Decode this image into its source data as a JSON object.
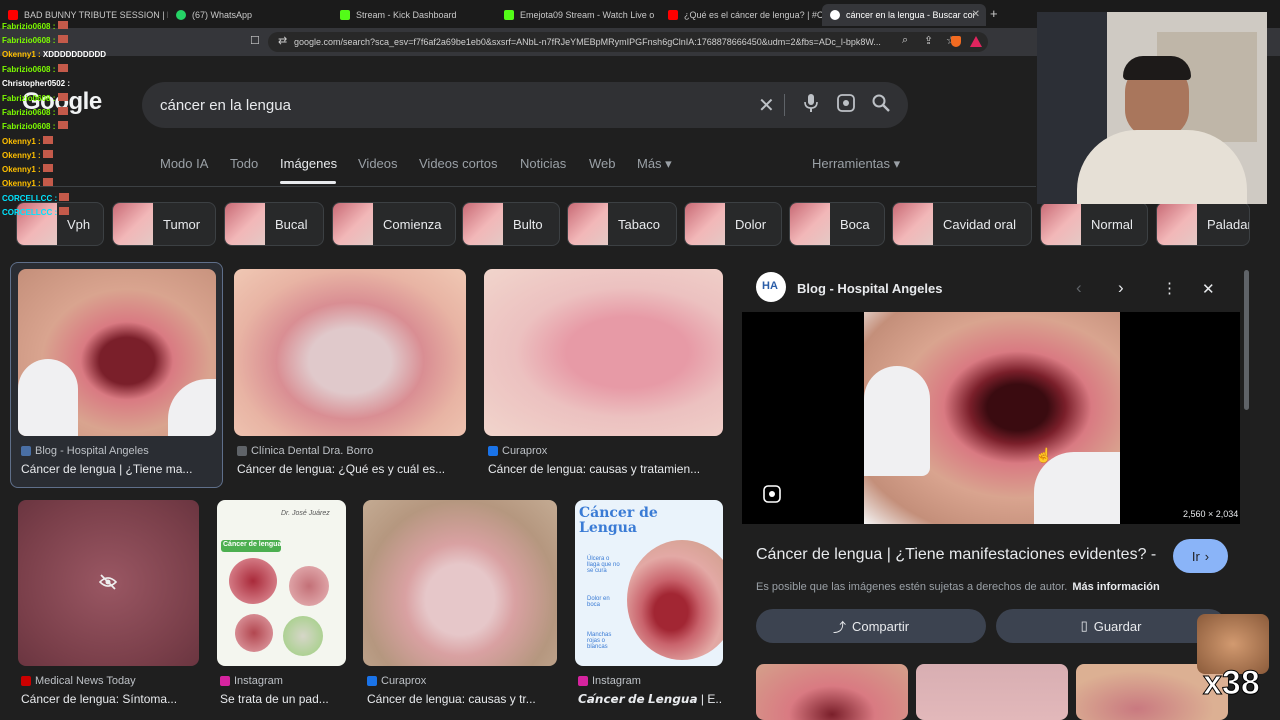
{
  "browser": {
    "tabs": [
      {
        "label": "BAD BUNNY TRIBUTE SESSION | DtM",
        "color": "#ff0000"
      },
      {
        "label": "(67) WhatsApp",
        "color": "#25d366"
      },
      {
        "label": "Stream - Kick Dashboard",
        "color": "#53fc18"
      },
      {
        "label": "Emejota09 Stream - Watch Live o",
        "color": "#53fc18"
      },
      {
        "label": "¿Qué es el cáncer de lengua? | #Cáp",
        "color": "#ff0000"
      },
      {
        "label": "cáncer en la lengua - Buscar con",
        "color": "#ffffff"
      }
    ],
    "url": "google.com/search?sca_esv=f7f6af2a69be1eb0&sxsrf=ANbL-n7fRJeYMEBpMRymIPGFnsh6gClnIA:1768878666450&udm=2&fbs=ADc_l-bpk8W..."
  },
  "search": {
    "logo": "Google",
    "query": "cáncer en la lengua"
  },
  "nav": {
    "tabs": [
      "Modo IA",
      "Todo",
      "Imágenes",
      "Videos",
      "Videos cortos",
      "Noticias",
      "Web",
      "Más ▾"
    ],
    "tools": "Herramientas ▾"
  },
  "chips": [
    "Vph",
    "Tumor",
    "Bucal",
    "Comienza",
    "Bulto",
    "Tabaco",
    "Dolor",
    "Boca",
    "Cavidad oral",
    "Normal",
    "Paladar"
  ],
  "results": [
    {
      "source": "Blog - Hospital Angeles",
      "title": "Cáncer de lengua | ¿Tiene ma..."
    },
    {
      "source": "Clínica Dental Dra. Borro",
      "title": "Cáncer de lengua: ¿Qué es y cuál es..."
    },
    {
      "source": "Curaprox",
      "title": "Cáncer de lengua: causas y tratamien..."
    },
    {
      "source": "Medical News Today",
      "title": "Cáncer de lengua: Síntoma..."
    },
    {
      "source": "Instagram",
      "title": "Se trata de un pad..."
    },
    {
      "source": "Curaprox",
      "title": "Cáncer de lengua: causas y tr..."
    },
    {
      "source": "Instagram",
      "title": "𝘾𝙖́𝙣𝙘𝙚𝙧 𝙙𝙚 𝙇𝙚𝙣𝙜𝙪𝙖 | E..."
    }
  ],
  "result_img_text": {
    "instagram1_heading": "Cáncer de lengua",
    "instagram1_brand": "Dr. José Juárez",
    "instagram2_title": "Cáncer de Lengua",
    "instagram2_notes": [
      "Úlcera o llaga que no se cura",
      "Dolor en boca",
      "Manchas rojas o blancas"
    ]
  },
  "panel": {
    "source": "Blog - Hospital Angeles",
    "source_abbr": "HA",
    "dimensions": "2,560 × 2,034",
    "title": "Cáncer de lengua | ¿Tiene manifestaciones evidentes? -",
    "visit_label": "Ir",
    "copyright": "Es posible que las imágenes estén sujetas a derechos de autor.",
    "more_info": "Más información",
    "share_label": "Compartir",
    "save_label": "Guardar"
  },
  "chat": [
    {
      "user": "Fabrizio0608 :",
      "msg": "",
      "color": "#7cfc00"
    },
    {
      "user": "Fabrizio0608 :",
      "msg": "",
      "color": "#7cfc00"
    },
    {
      "user": "Okenny1 :",
      "msg": "XDDDDDDDDDD",
      "color": "#ffc000"
    },
    {
      "user": "Fabrizio0608 :",
      "msg": "",
      "color": "#7cfc00"
    },
    {
      "user": "Christopher0502 :",
      "msg": "",
      "color": "#ffffff"
    },
    {
      "user": "Fabrizio0608 :",
      "msg": "",
      "color": "#7cfc00"
    },
    {
      "user": "Fabrizio0608 :",
      "msg": "",
      "color": "#7cfc00"
    },
    {
      "user": "Fabrizio0608 :",
      "msg": "",
      "color": "#7cfc00"
    },
    {
      "user": "Okenny1 :",
      "msg": "",
      "color": "#ffc000"
    },
    {
      "user": "Okenny1 :",
      "msg": "",
      "color": "#ffc000"
    },
    {
      "user": "Okenny1 :",
      "msg": "",
      "color": "#ffc000"
    },
    {
      "user": "Okenny1 :",
      "msg": "",
      "color": "#ffc000"
    },
    {
      "user": "CORCELLCC :",
      "msg": "",
      "color": "#00e5ff"
    },
    {
      "user": "CORCELLCC :",
      "msg": "",
      "color": "#00e5ff"
    }
  ],
  "overlay": {
    "combo": "x38"
  }
}
